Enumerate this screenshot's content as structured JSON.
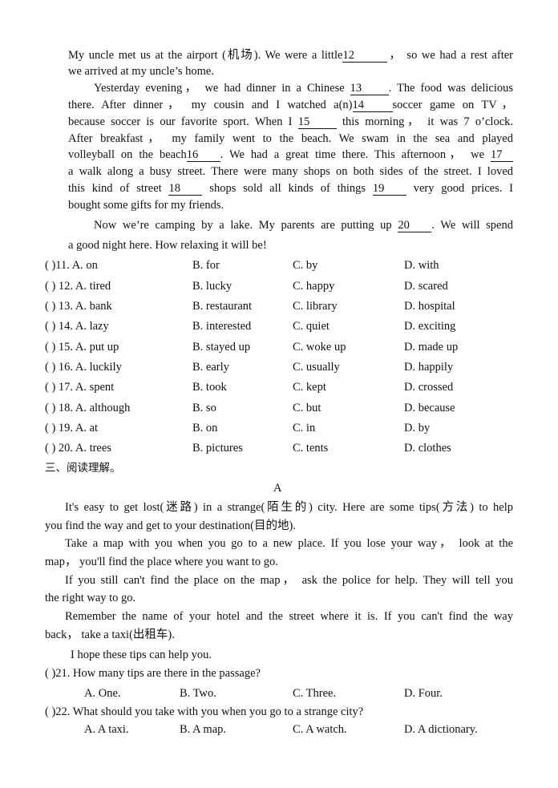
{
  "cloze_passage": {
    "lines": [
      {
        "pre": "My uncle met us at the airport (机场). We were a little",
        "blank": "12",
        "post": "， so we had a rest after"
      },
      {
        "text": "we arrived at my uncle’s home."
      },
      {
        "pre": "Yesterday evening， we had dinner in a Chinese ",
        "blank": "13",
        "post": ". The food was delicious"
      },
      {
        "pre": "there. After dinner， my cousin and I watched a(n)",
        "blank": "14",
        "post": "soccer game on TV，"
      },
      {
        "pre": "because soccer is our favorite sport. When I ",
        "blank": "15",
        "post": " this morning， it was 7 o’clock."
      },
      {
        "text": "After breakfast， my family went to the beach. We swam in the sea and played"
      },
      {
        "pre": "volleyball on the beach",
        "blank": "16",
        "post": ". We had a great time there. This afternoon， we ",
        "blank2": "17"
      },
      {
        "text": "a walk along a busy street. There were many shops on both sides of the street. I loved"
      },
      {
        "pre": "this kind of street ",
        "blank": "18",
        "mid": " shops sold all kinds of things ",
        "blank2": "19",
        "post": " very good prices. I"
      },
      {
        "text": "bought some gifts for my friends."
      },
      {
        "pre": "Now we’re camping by a lake. My parents are putting up ",
        "blank": "20",
        "post": ". We will spend"
      },
      {
        "text": "a good night here. How relaxing it will be!"
      }
    ]
  },
  "cloze_questions": [
    {
      "num": "(     )11. A. on",
      "b": "B. for",
      "c": "C. by",
      "d": "D. with"
    },
    {
      "num": "(     ) 12. A. tired",
      "b": "B. lucky",
      "c": "C. happy",
      "d": "D. scared"
    },
    {
      "num": "(     ) 13. A. bank",
      "b": "B. restaurant",
      "c": "C. library",
      "d": "D. hospital"
    },
    {
      "num": "(     ) 14. A. lazy",
      "b": "B. interested",
      "c": "C. quiet",
      "d": "D. exciting"
    },
    {
      "num": "(     ) 15. A. put up",
      "b": "B. stayed up",
      "c": "C. woke up",
      "d": "D. made up"
    },
    {
      "num": "(     ) 16. A. luckily",
      "b": "B. early",
      "c": "C. usually",
      "d": "D. happily"
    },
    {
      "num": "(     ) 17. A. spent",
      "b": "B. took",
      "c": "C. kept",
      "d": "D. crossed"
    },
    {
      "num": "(     ) 18. A. although",
      "b": "B. so",
      "c": "C. but",
      "d": "D. because"
    },
    {
      "num": "(     ) 19. A. at",
      "b": "B. on",
      "c": "C. in",
      "d": "D. by"
    },
    {
      "num": "(     ) 20. A. trees",
      "b": "B. pictures",
      "c": "C. tents",
      "d": "D. clothes"
    }
  ],
  "section_heading": "三、阅读理解。",
  "reading_a": {
    "title": "A",
    "lines": [
      "It's easy to get lost(迷路) in a strange(陌生的) city. Here are some tips(方法) to help",
      "you find the way and get to your destination(目的地).",
      "Take a map with you when you go to a new place. If you lose your way， look at the",
      "map， you'll find the place where you want to go.",
      "If you still can't find the place on the map， ask the police for help. They will tell you",
      "the right way to go.",
      "Remember the name of your hotel and the street where it is. If you can't find the way",
      "back， take a taxi(出租车).",
      "I hope these tips can help you."
    ],
    "questions": [
      {
        "stem": "(     )21.   How many tips are there in the passage?",
        "a": "A. One.",
        "b": "B. Two.",
        "c": "C. Three.",
        "d": "D. Four."
      },
      {
        "stem": "(     )22.   What should you take with you when you go to a strange city?",
        "a": "A. A taxi.",
        "b": "B. A map.",
        "c": "C. A watch.",
        "d": "D. A dictionary."
      }
    ]
  }
}
